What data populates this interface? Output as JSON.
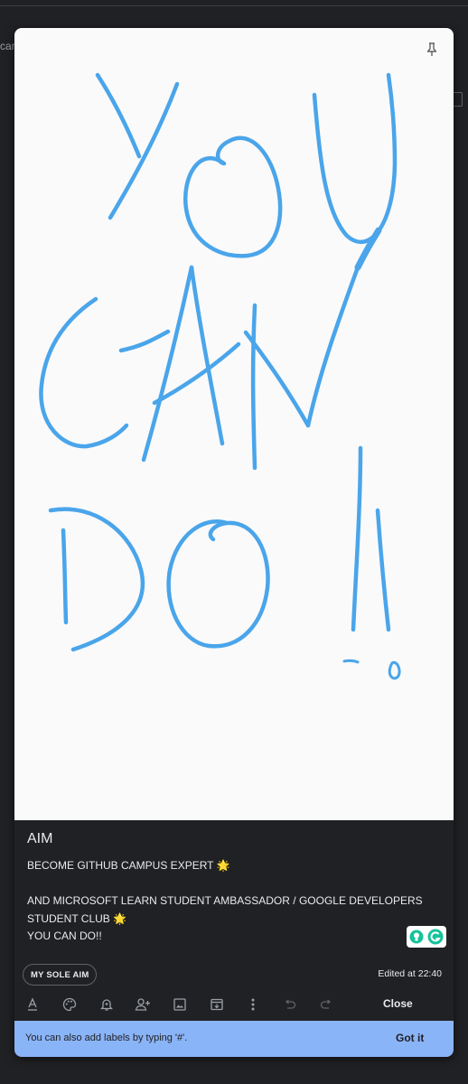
{
  "background": {
    "partial_text": "car"
  },
  "note": {
    "title": "AIM",
    "body_lines": [
      "BECOME GITHUB CAMPUS EXPERT 🌟",
      "",
      "AND MICROSOFT LEARN STUDENT AMBASSADOR / GOOGLE DEVELOPERS",
      "STUDENT CLUB 🌟",
      "YOU CAN DO!!"
    ],
    "label_chip": "MY SOLE AIM",
    "edited_text": "Edited at 22:40",
    "drawing": {
      "ink_color": "#4aa5ea",
      "background": "#fafafa",
      "handwritten_text": "YOU CAN DO !!"
    }
  },
  "toolbar": {
    "icons": [
      "text-format-icon",
      "palette-icon",
      "reminder-bell-icon",
      "collaborator-icon",
      "image-icon",
      "archive-icon",
      "more-vert-icon",
      "undo-icon",
      "redo-icon"
    ],
    "close_label": "Close"
  },
  "toast": {
    "message": "You can also add labels by typing '#'.",
    "action_label": "Got it",
    "color": "#8ab4f8"
  }
}
